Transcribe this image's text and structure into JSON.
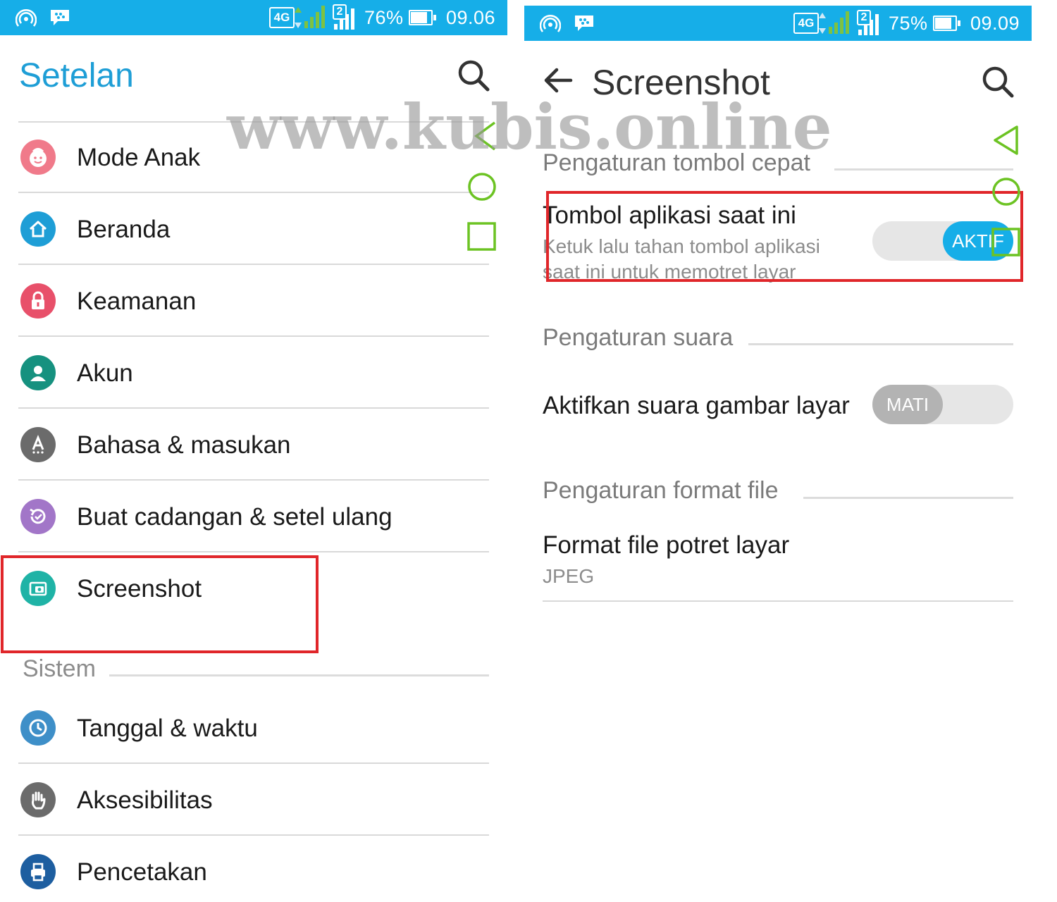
{
  "watermark": "www.kubis.online",
  "colors": {
    "accent": "#16aee8",
    "title_blue": "#1e9ed6",
    "highlight_red": "#e0262a",
    "nav_green": "#6cc323"
  },
  "left_status": {
    "network": "4G",
    "sim2": "2",
    "battery": "76%",
    "battery_level": 0.76,
    "time": "09.06"
  },
  "right_status": {
    "network": "4G",
    "sim2": "2",
    "battery": "75%",
    "battery_level": 0.75,
    "time": "09.09"
  },
  "left": {
    "title": "Setelan",
    "items": [
      {
        "label": "Mode Anak",
        "icon": "kid-face-icon",
        "color": "#f07a8a"
      },
      {
        "label": "Beranda",
        "icon": "home-icon",
        "color": "#1e9ed6"
      },
      {
        "label": "Keamanan",
        "icon": "lock-icon",
        "color": "#e8506a"
      },
      {
        "label": "Akun",
        "icon": "account-icon",
        "color": "#16917f"
      },
      {
        "label": "Bahasa & masukan",
        "icon": "language-icon",
        "color": "#6b6b6b"
      },
      {
        "label": "Buat cadangan & setel ulang",
        "icon": "backup-icon",
        "color": "#a276c8"
      },
      {
        "label": "Screenshot",
        "icon": "screenshot-icon",
        "color": "#1fb3a6"
      }
    ],
    "section_system": "Sistem",
    "system_items": [
      {
        "label": "Tanggal & waktu",
        "icon": "clock-icon",
        "color": "#3e8fc8"
      },
      {
        "label": "Aksesibilitas",
        "icon": "hand-icon",
        "color": "#6b6b6b"
      },
      {
        "label": "Pencetakan",
        "icon": "printer-icon",
        "color": "#1d5ea0"
      }
    ]
  },
  "right": {
    "title": "Screenshot",
    "section_quick": "Pengaturan tombol cepat",
    "quick_item_title": "Tombol aplikasi saat ini",
    "quick_item_sub": "Ketuk lalu tahan tombol aplikasi saat ini untuk memotret layar",
    "quick_toggle": "AKTIF",
    "section_sound": "Pengaturan suara",
    "sound_item_title": "Aktifkan suara gambar layar",
    "sound_toggle": "MATI",
    "section_format": "Pengaturan format file",
    "format_item_title": "Format file potret layar",
    "format_item_value": "JPEG"
  }
}
